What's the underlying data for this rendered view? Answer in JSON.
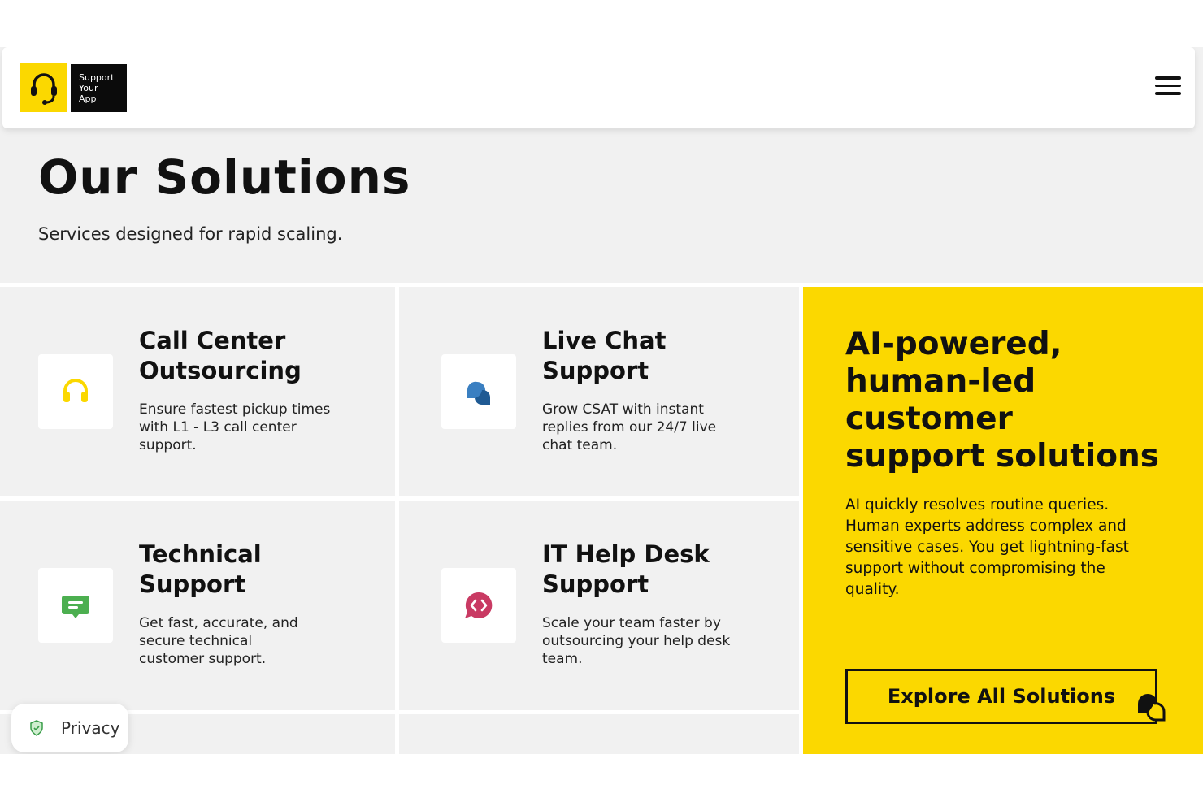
{
  "header": {
    "logo_lines": [
      "Support",
      "Your",
      "App"
    ],
    "menu_icon": "hamburger-menu-icon"
  },
  "hero": {
    "title": "Our Solutions",
    "subtitle": "Services designed for rapid scaling."
  },
  "cards": [
    {
      "icon": "headset-icon",
      "icon_color": "#fbd800",
      "title_1": "Call Center",
      "title_2": "Outsourcing",
      "desc_1": "Ensure fastest pickup times",
      "desc_2": "with L1 - L3 call center",
      "desc_3": "support."
    },
    {
      "icon": "chat-bubbles-icon",
      "icon_color": "#3a7fc1",
      "title_1": "Live Chat",
      "title_2": "Support",
      "desc_1": "Grow CSAT with instant",
      "desc_2": "replies from our 24/7 live",
      "desc_3": "chat team."
    },
    {
      "icon": "message-icon",
      "icon_color": "#4caf50",
      "title_1": "Technical",
      "title_2": "Support",
      "desc_1": "Get fast, accurate, and",
      "desc_2": "secure technical",
      "desc_3": "customer support."
    },
    {
      "icon": "code-chat-icon",
      "icon_color": "#c93a63",
      "title_1": "IT Help Desk",
      "title_2": "Support",
      "desc_1": "Scale your team faster by",
      "desc_2": "outsourcing your help desk",
      "desc_3": "team."
    }
  ],
  "promo": {
    "title_lines": [
      "AI-powered,",
      "human-led",
      "customer",
      "support solutions"
    ],
    "text_lines": [
      "AI quickly resolves routine queries.",
      "Human experts address complex and",
      "sensitive cases. You get lightning-fast",
      "support without compromising the",
      "quality."
    ],
    "button_label": "Explore All Solutions",
    "background": "#fbd800"
  },
  "privacy": {
    "label": "Privacy"
  }
}
